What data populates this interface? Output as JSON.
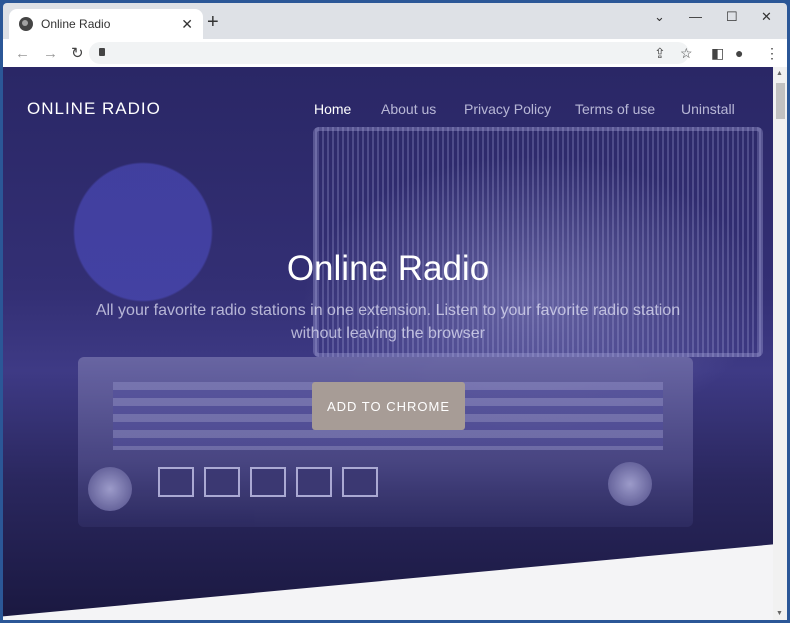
{
  "browser": {
    "tab_title": "Online Radio",
    "tab_icon": "globe-icon",
    "new_tab": "+",
    "close_tab": "✕",
    "url": ""
  },
  "site": {
    "logo": "ONLINE RADIO",
    "nav": [
      {
        "label": "Home",
        "active": true
      },
      {
        "label": "About us"
      },
      {
        "label": "Privacy Policy"
      },
      {
        "label": "Terms of use"
      },
      {
        "label": "Uninstall"
      }
    ],
    "hero": {
      "title": "Online Radio",
      "subtitle": "All your favorite radio stations in one extension. Listen to your favorite radio station without leaving the browser",
      "cta": "ADD TO CHROME"
    }
  },
  "colors": {
    "hero_overlay": "#2a2766",
    "cta": "#a79c96",
    "frame": "#2b5797"
  }
}
